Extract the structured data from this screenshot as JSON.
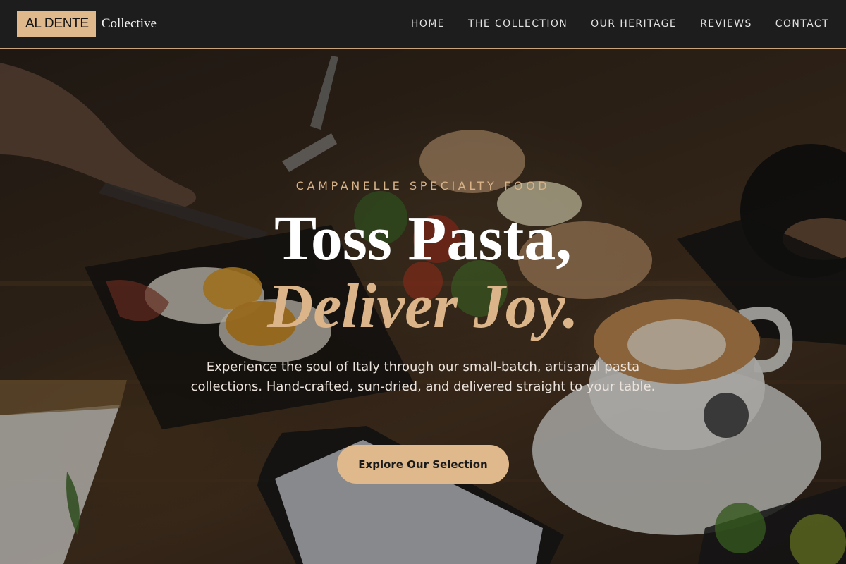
{
  "brand": {
    "name": "AL DENTE",
    "suffix": "Collective"
  },
  "nav": {
    "items": [
      {
        "label": "HOME"
      },
      {
        "label": "THE COLLECTION"
      },
      {
        "label": "OUR HERITAGE"
      },
      {
        "label": "REVIEWS"
      },
      {
        "label": "CONTACT"
      }
    ]
  },
  "hero": {
    "eyebrow": "CAMPANELLE SPECIALTY FOOD",
    "title_line1": "Toss Pasta,",
    "title_line2": "Deliver Joy.",
    "description": "Experience the soul of Italy through our small-batch, artisanal pasta collections. Hand-crafted, sun-dried, and delivered straight to your table.",
    "cta_label": "Explore Our Selection"
  },
  "colors": {
    "accent": "#dfb88b",
    "header_bg": "#1d1d1d",
    "text_light": "#ffffff"
  }
}
